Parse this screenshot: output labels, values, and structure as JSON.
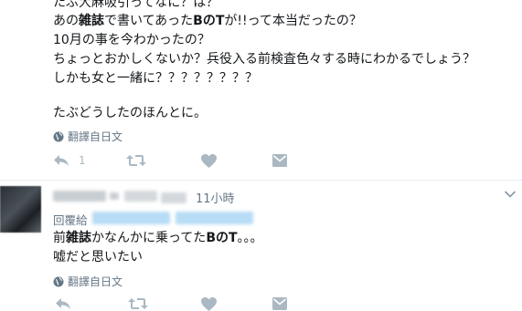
{
  "tweet1": {
    "lines": [
      "たぶ大麻吸引ってなに？は？",
      "あの雑誌で書いてあったBのTが!!って本当だったの？",
      "10月の事を今わかったの？",
      "ちょっとおかしくないか？兵役入る前検査色々する時にわかるでしょう？",
      "しかも女と一緒に？？？？？？？？",
      "",
      "たぶどうしたのほんとに。"
    ],
    "translate_label": "翻譯自日文",
    "reply_count": "1"
  },
  "tweet2": {
    "time": "11小時",
    "reply_prefix": "回覆給",
    "line1_pre": "前",
    "line1_bold1": "雑誌",
    "line1_mid": "かなんかに乗ってた",
    "line1_bold2": "BのT",
    "line1_post": "。。。",
    "line2": "嘘だと思いたい",
    "translate_label": "翻譯自日文"
  },
  "icons": [
    "reply-icon",
    "retweet-icon",
    "like-icon",
    "dm-icon",
    "globe-icon",
    "caret-down-icon"
  ],
  "colors": {
    "muted": "#657786",
    "action": "#aab8c2",
    "divider": "#e6ecf0"
  }
}
